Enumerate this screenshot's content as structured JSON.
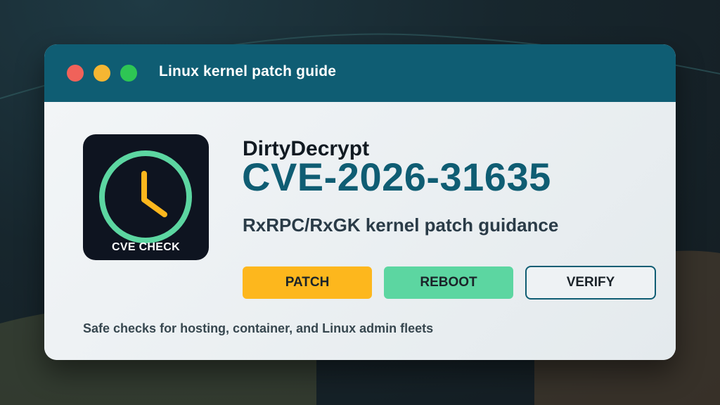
{
  "window": {
    "title": "Linux kernel patch guide"
  },
  "icon": {
    "name": "clock-icon",
    "label": "CVE CHECK"
  },
  "main": {
    "product_name": "DirtyDecrypt",
    "cve_id": "CVE-2026-31635",
    "subtitle": "RxRPC/RxGK kernel patch guidance"
  },
  "actions": {
    "patch_label": "PATCH",
    "reboot_label": "REBOOT",
    "verify_label": "VERIFY"
  },
  "footer": {
    "text": "Safe checks for hosting, container, and Linux admin fleets"
  },
  "colors": {
    "accent": "#0f5d73",
    "patch": "#fdb71d",
    "reboot": "#5cd6a1",
    "close": "#f0625a",
    "minimize": "#f6b632",
    "maximize": "#2ec654"
  }
}
